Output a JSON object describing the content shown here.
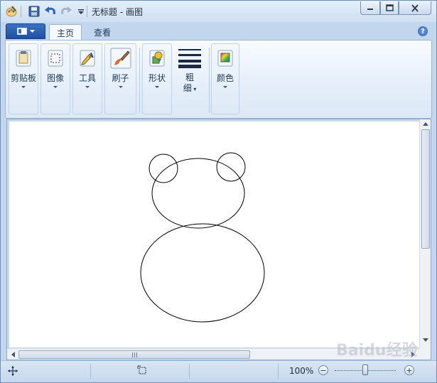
{
  "window": {
    "title": "无标题 - 画图"
  },
  "quick_access": {
    "icons": [
      "paint-app-icon",
      "save-icon",
      "undo-icon",
      "redo-icon",
      "customize-dropdown-icon"
    ]
  },
  "tabs": [
    {
      "label": "主页",
      "active": true
    },
    {
      "label": "查看",
      "active": false
    }
  ],
  "help": {
    "label": "?"
  },
  "ribbon": {
    "clipboard": {
      "label": "剪贴板"
    },
    "image": {
      "label": "图像"
    },
    "tools": {
      "label": "工具"
    },
    "brushes": {
      "label": "刷子"
    },
    "shapes": {
      "label": "形状"
    },
    "size": {
      "label_line1": "粗",
      "label_line2": "细"
    },
    "colors": {
      "label": "颜色"
    }
  },
  "status": {
    "zoom": "100%",
    "zoom_level_percent": 100,
    "zoom_out": "−",
    "zoom_in": "+"
  },
  "watermark": "Baidu经验",
  "colors": {
    "accent": "#1d4fa0",
    "ribbon_bg": "#e4eef9",
    "canvas": "#ffffff",
    "stroke": "#000000"
  }
}
